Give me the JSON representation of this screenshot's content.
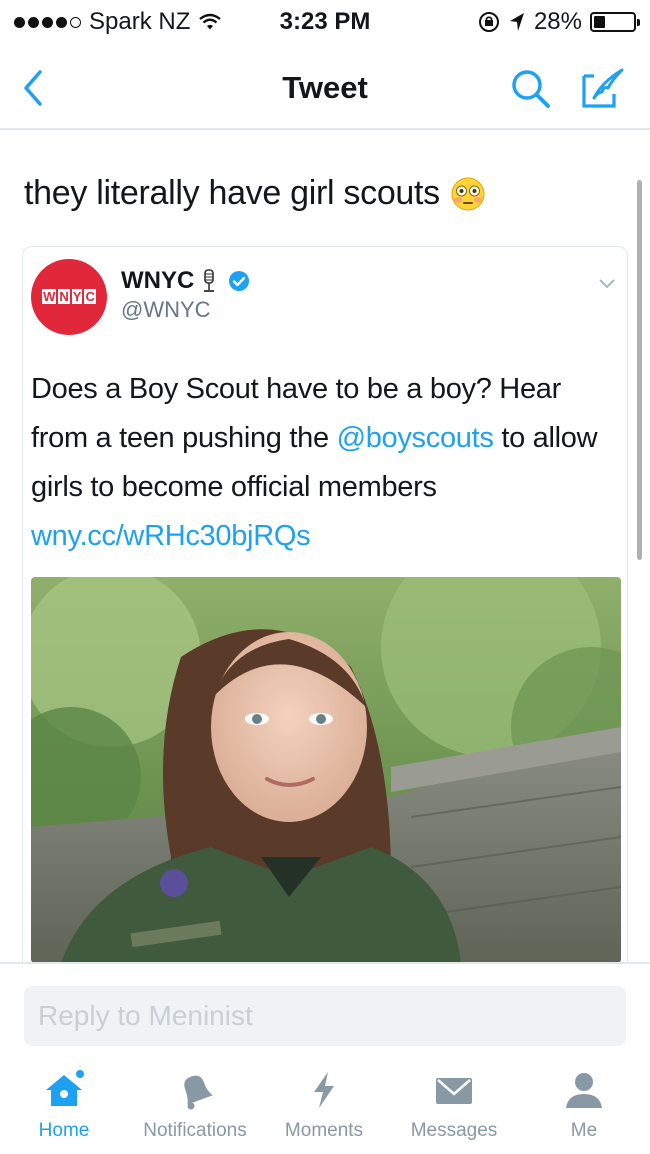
{
  "status_bar": {
    "carrier": "Spark NZ",
    "time": "3:23 PM",
    "battery": "28%",
    "battery_level": 0.28,
    "signal_bars": 4
  },
  "nav": {
    "title": "Tweet",
    "back_icon": "chevron-left-icon",
    "search_icon": "search-icon",
    "compose_icon": "compose-icon"
  },
  "tweet": {
    "text": "they literally have girl scouts",
    "emoji": "flushed-face-emoji"
  },
  "quoted_tweet": {
    "avatar_text": [
      "W",
      "N",
      "Y",
      "C"
    ],
    "author_name": "WNYC",
    "author_handle": "@WNYC",
    "text_before": "Does a Boy Scout have to be a boy? Hear from a teen pushing the ",
    "mention": "@boyscouts",
    "text_after": " to allow girls to become official members",
    "link": "wny.cc/wRHc30bjRQs"
  },
  "reply": {
    "placeholder": "Reply to Meninist"
  },
  "tabs": [
    {
      "label": "Home",
      "icon": "home-icon",
      "active": true
    },
    {
      "label": "Notifications",
      "icon": "bell-icon",
      "active": false
    },
    {
      "label": "Moments",
      "icon": "lightning-icon",
      "active": false
    },
    {
      "label": "Messages",
      "icon": "envelope-icon",
      "active": false
    },
    {
      "label": "Me",
      "icon": "person-icon",
      "active": false
    }
  ],
  "colors": {
    "accent": "#1da1f2",
    "inactive": "#8899a6",
    "avatar_red": "#e0283a"
  }
}
